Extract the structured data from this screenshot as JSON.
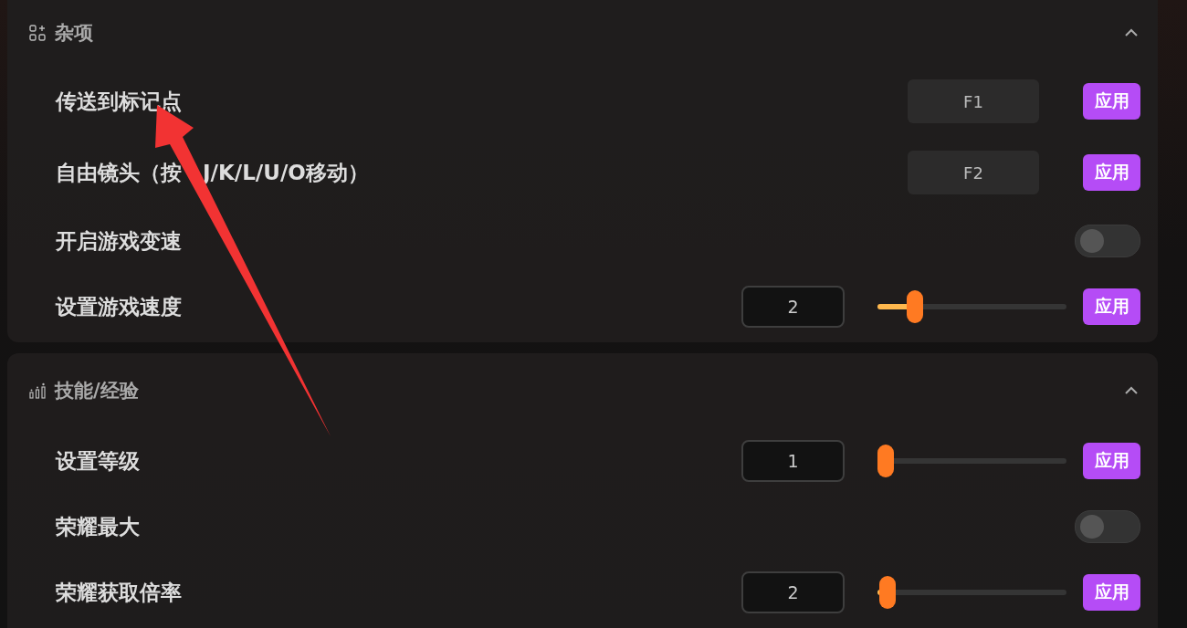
{
  "sections": [
    {
      "title": "杂项",
      "expanded": true,
      "rows": [
        {
          "kind": "key",
          "label": "传送到标记点",
          "key": "F1",
          "button": "应用"
        },
        {
          "kind": "key",
          "label": "自由镜头（按",
          "label_rest": "J/K/L/U/O移动）",
          "key": "F2",
          "button": "应用"
        },
        {
          "kind": "toggle",
          "label": "开启游戏变速",
          "on": false
        },
        {
          "kind": "slider",
          "label": "设置游戏速度",
          "value": "2",
          "level": 0.17,
          "button": "应用"
        }
      ]
    },
    {
      "title": "技能/经验",
      "expanded": true,
      "rows": [
        {
          "kind": "slider",
          "label": "设置等级",
          "value": "1",
          "level": 0,
          "button": "应用"
        },
        {
          "kind": "toggle",
          "label": "荣耀最大",
          "on": false
        },
        {
          "kind": "slider",
          "label": "荣耀获取倍率",
          "value": "2",
          "level": 0.01,
          "button": "应用"
        }
      ]
    }
  ]
}
